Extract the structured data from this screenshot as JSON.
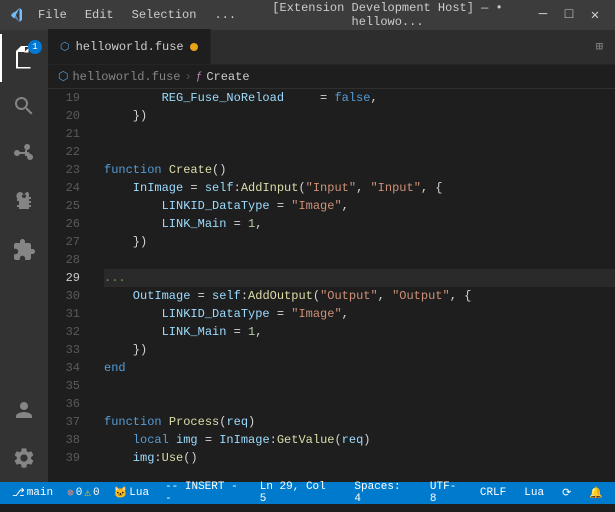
{
  "titlebar": {
    "menu_items": [
      "File",
      "Edit",
      "Selection",
      "..."
    ],
    "title": "[Extension Development Host] — • hellowo...",
    "min_label": "─",
    "max_label": "□",
    "close_label": "✕"
  },
  "tabs": {
    "active_tab": {
      "label": "helloworld.fuse",
      "modified": true
    },
    "layout_icon": "⊞"
  },
  "breadcrumb": {
    "parts": [
      "helloworld.fuse",
      "Create"
    ],
    "separator": "›"
  },
  "lines": [
    {
      "num": 19,
      "code": "        REG_Fuse_NoReload     = false,"
    },
    {
      "num": 20,
      "code": "    })"
    },
    {
      "num": 21,
      "code": ""
    },
    {
      "num": 22,
      "code": ""
    },
    {
      "num": 23,
      "code": "function Create()"
    },
    {
      "num": 24,
      "code": "    InImage = self:AddInput(\"Input\", \"Input\", {"
    },
    {
      "num": 25,
      "code": "        LINKID_DataType = \"Image\","
    },
    {
      "num": 26,
      "code": "        LINK_Main = 1,"
    },
    {
      "num": 27,
      "code": "    })"
    },
    {
      "num": 28,
      "code": ""
    },
    {
      "num": 29,
      "code": "...",
      "is_current": true,
      "is_ellipsis": true
    },
    {
      "num": 30,
      "code": "    OutImage = self:AddOutput(\"Output\", \"Output\", {"
    },
    {
      "num": 31,
      "code": "        LINKID_DataType = \"Image\","
    },
    {
      "num": 32,
      "code": "        LINK_Main = 1,"
    },
    {
      "num": 33,
      "code": "    })"
    },
    {
      "num": 34,
      "code": "end"
    },
    {
      "num": 35,
      "code": ""
    },
    {
      "num": 36,
      "code": ""
    },
    {
      "num": 37,
      "code": "function Process(req)"
    },
    {
      "num": 38,
      "code": "    local img = InImage:GetValue(req)"
    },
    {
      "num": 39,
      "code": "    img:Use()"
    }
  ],
  "statusbar": {
    "source_control_count": "1",
    "warnings": "0",
    "errors": "0",
    "language": "Lua",
    "mode": "-- INSERT --",
    "position": "Ln 29, Col 5",
    "spaces": "Spaces: 4",
    "encoding": "UTF-8",
    "line_ending": "CRLF",
    "lang_display": "Lua",
    "sync_icon": "⟳",
    "bell_icon": "🔔"
  }
}
